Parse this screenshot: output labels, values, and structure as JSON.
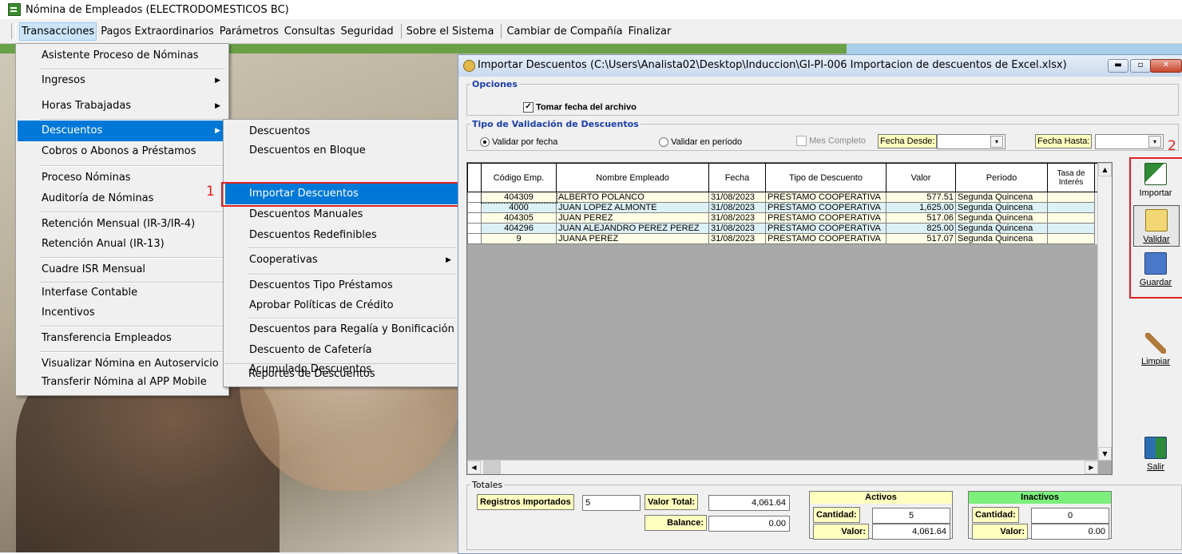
{
  "window": {
    "title": "Nómina de Empleados (ELECTRODOMESTICOS BC)"
  },
  "menubar": [
    "Transacciones",
    "Pagos Extraordinarios",
    "Parámetros",
    "Consultas",
    "Seguridad",
    "Sobre el Sistema",
    "Cambiar de Compañía",
    "Finalizar"
  ],
  "menu1": [
    {
      "label": "Asistente Proceso de Nóminas"
    },
    {
      "label": "Ingresos",
      "sub": true
    },
    {
      "label": "Horas Trabajadas",
      "sub": true
    },
    {
      "label": "Descuentos",
      "sub": true,
      "active": true
    },
    {
      "label": "Cobros o Abonos a Préstamos"
    },
    {
      "label": "Proceso Nóminas",
      "marker": "1"
    },
    {
      "label": "Auditoría de Nóminas"
    },
    {
      "label": "Retención Mensual  (IR-3/IR-4)"
    },
    {
      "label": "Retención Anual  (IR-13)"
    },
    {
      "label": "Cuadre ISR Mensual"
    },
    {
      "label": "Interfase Contable"
    },
    {
      "label": "Incentivos"
    },
    {
      "label": "Transferencia Empleados"
    },
    {
      "label": "Visualizar Nómina en Autoservicio"
    },
    {
      "label": "Transferir Nómina al APP Mobile"
    }
  ],
  "menu2": [
    {
      "label": "Descuentos"
    },
    {
      "label": "Descuentos en Bloque"
    },
    {
      "label": "Importar Descuentos",
      "active": true
    },
    {
      "label": "Descuentos Manuales"
    },
    {
      "label": "Descuentos Redefinibles"
    },
    {
      "label": "Cooperativas",
      "sub": true
    },
    {
      "label": "Descuentos Tipo Préstamos"
    },
    {
      "label": "Aprobar Políticas de Crédito"
    },
    {
      "label": "Descuentos  para Regalía y Bonificación"
    },
    {
      "label": "Descuento de Cafetería"
    },
    {
      "label": "Acumulado Descuentos"
    },
    {
      "label": "Reportes de Descuentos"
    }
  ],
  "markers": {
    "one": "1",
    "two": "2"
  },
  "dialog": {
    "title": "Importar Descuentos (C:\\Users\\Analista02\\Desktop\\Induccion\\GI-PI-006 Importacion de descuentos de Excel.xlsx)",
    "opciones_legend": "Opciones",
    "tomar_fecha": "Tomar fecha del archivo",
    "tipo_legend": "Tipo de Validación de Descuentos",
    "validar_fecha": "Validar por fecha",
    "validar_periodo": "Validar en período",
    "mes_completo": "Mes Completo",
    "fecha_desde": "Fecha Desde:",
    "fecha_hasta": "Fecha Hasta:",
    "columns": [
      "Código Emp.",
      "Nombre Empleado",
      "Fecha",
      "Tipo de Descuento",
      "Valor",
      "Período",
      "Tasa de Interés"
    ],
    "rows": [
      [
        "404309",
        "ALBERTO POLANCO",
        "31/08/2023",
        "PRESTAMO COOPERATIVA",
        "577.51",
        "Segunda Quincena",
        ""
      ],
      [
        "4000",
        "JUAN LOPEZ ALMONTE",
        "31/08/2023",
        "PRESTAMO COOPERATIVA",
        "1,625.00",
        "Segunda Quincena",
        ""
      ],
      [
        "404305",
        "JUAN PEREZ",
        "31/08/2023",
        "PRESTAMO COOPERATIVA",
        "517.06",
        "Segunda Quincena",
        ""
      ],
      [
        "404296",
        "JUAN ALEJANDRO PEREZ PEREZ",
        "31/08/2023",
        "PRESTAMO COOPERATIVA",
        "825.00",
        "Segunda Quincena",
        ""
      ],
      [
        "9",
        "JUANA PEREZ",
        "31/08/2023",
        "PRESTAMO COOPERATIVA",
        "517.07",
        "Segunda Quincena",
        ""
      ]
    ],
    "buttons": {
      "importar": "Importar",
      "validar": "Validar",
      "guardar": "Guardar",
      "limpiar": "Limpiar",
      "salir": "Salir"
    },
    "totales": {
      "legend": "Totales",
      "registros_label": "Registros Importados",
      "registros_value": "5",
      "valor_total_label": "Valor Total:",
      "valor_total": "4,061.64",
      "balance_label": "Balance:",
      "balance": "0.00",
      "activos": "Activos",
      "inactivos": "Inactivos",
      "cantidad_label": "Cantidad:",
      "valor_label": "Valor:",
      "activos_cantidad": "5",
      "activos_valor": "4,061.64",
      "inactivos_cantidad": "0",
      "inactivos_valor": "0.00"
    }
  },
  "colors": {
    "menu_highlight": "#0078d7",
    "annotation_red": "#e02020",
    "activos_bg": "#ffffc0",
    "inactivos_bg": "#7cf07c"
  }
}
